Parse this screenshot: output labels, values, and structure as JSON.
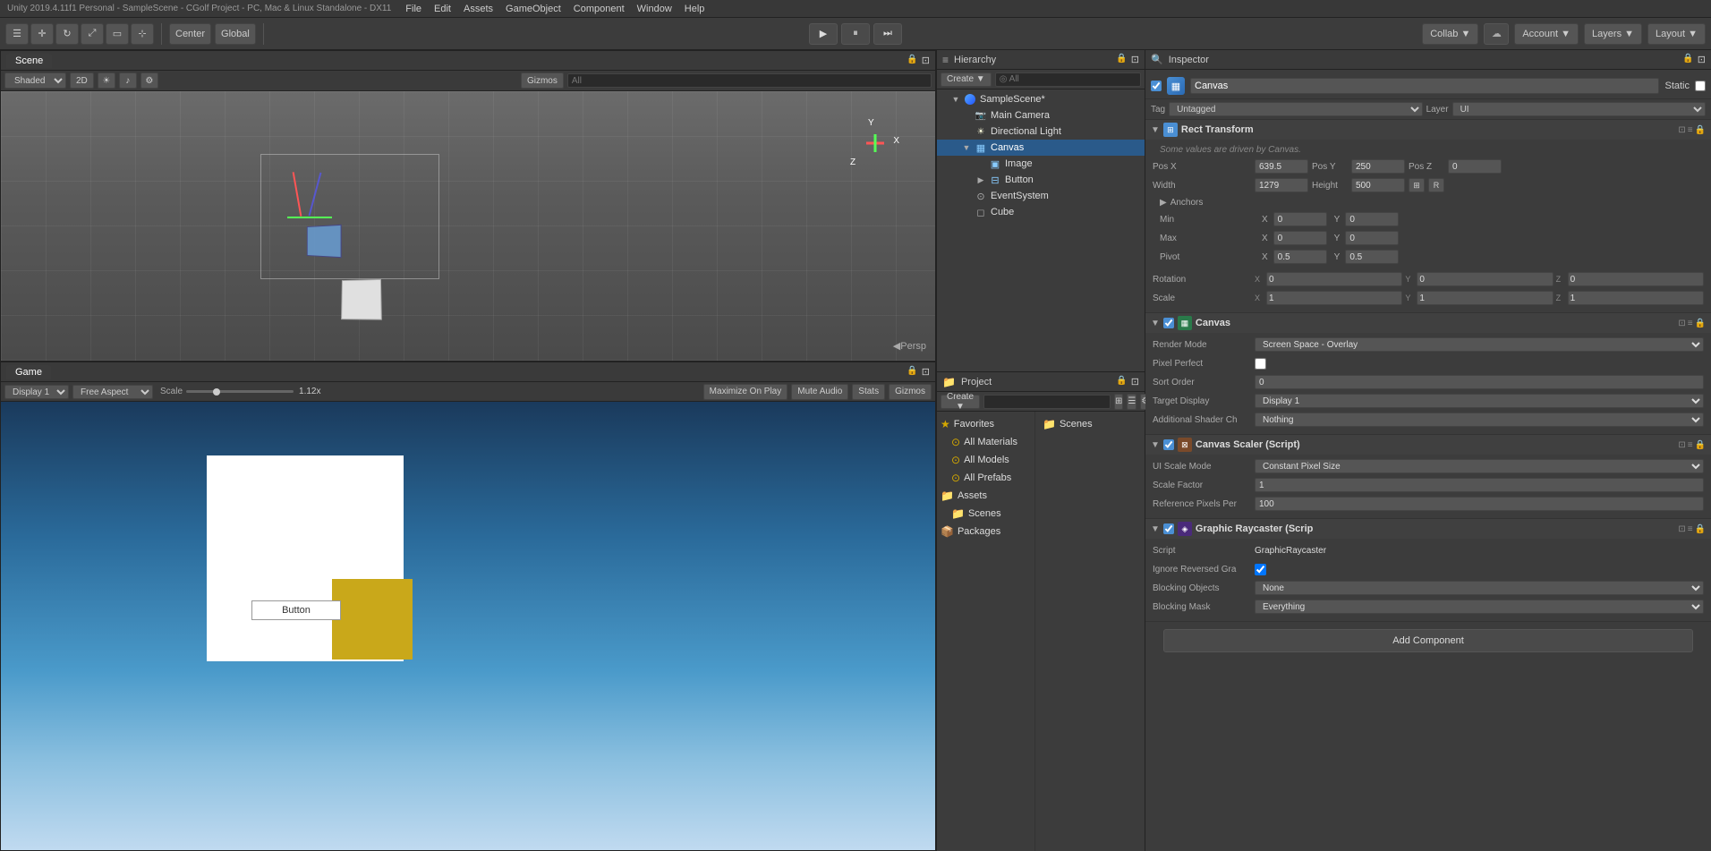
{
  "app": {
    "title": "Unity 2019.4.11f1 Personal - SampleScene - CGolf Project - PC, Mac & Linux Standalone - DX11"
  },
  "menubar": {
    "items": [
      "File",
      "Edit",
      "Assets",
      "GameObject",
      "Component",
      "Window",
      "Help"
    ]
  },
  "toolbar": {
    "transform_tools": [
      "hand",
      "move",
      "rotate",
      "scale",
      "rect",
      "transform"
    ],
    "pivot_center": "Center",
    "pivot_global": "Global",
    "play": "▶",
    "pause": "⏸",
    "step": "⏭",
    "collab": "Collab ▼",
    "account": "Account ▼",
    "layers": "Layers ▼",
    "layout": "Layout ▼"
  },
  "scene": {
    "tab": "Scene",
    "view_mode": "Shaded",
    "gizmos_btn": "Gizmos",
    "search_placeholder": "All",
    "persp_label": "◀Persp"
  },
  "game": {
    "tab": "Game",
    "display": "Display 1",
    "aspect": "Free Aspect",
    "scale_label": "Scale",
    "scale_value": "1.12x",
    "maximize_on_play": "Maximize On Play",
    "mute_audio": "Mute Audio",
    "stats": "Stats",
    "gizmos": "Gizmos",
    "button_label": "Button"
  },
  "hierarchy": {
    "title": "Hierarchy",
    "create_btn": "Create ▼",
    "search_placeholder": "◎ All",
    "scene_name": "SampleScene*",
    "items": [
      {
        "id": "main-camera",
        "label": "Main Camera",
        "indent": 1,
        "icon": "camera"
      },
      {
        "id": "directional-light",
        "label": "Directional Light",
        "indent": 1,
        "icon": "light"
      },
      {
        "id": "canvas",
        "label": "Canvas",
        "indent": 1,
        "icon": "canvas",
        "selected": true,
        "expanded": true
      },
      {
        "id": "image",
        "label": "Image",
        "indent": 2,
        "icon": "image"
      },
      {
        "id": "button",
        "label": "Button",
        "indent": 2,
        "icon": "button",
        "has_children": true
      },
      {
        "id": "eventsystem",
        "label": "EventSystem",
        "indent": 1,
        "icon": "eventsystem"
      },
      {
        "id": "cube",
        "label": "Cube",
        "indent": 1,
        "icon": "cube"
      }
    ]
  },
  "project": {
    "title": "Project",
    "create_btn": "Create ▼",
    "favorites": {
      "label": "Favorites",
      "items": [
        "All Materials",
        "All Models",
        "All Prefabs"
      ]
    },
    "assets": {
      "label": "Assets",
      "items": [
        "Scenes"
      ]
    },
    "packages": "Packages",
    "right_folders": [
      "Scenes"
    ]
  },
  "inspector": {
    "title": "Inspector",
    "object_name": "Canvas",
    "static_label": "Static",
    "tag_label": "Tag",
    "tag_value": "Untagged",
    "layer_label": "Layer",
    "layer_value": "UI",
    "components": [
      {
        "id": "rect-transform",
        "title": "Rect Transform",
        "icon": "⊞",
        "note": "Some values are driven by Canvas.",
        "fields": [
          {
            "label": "Pos X",
            "value": "639.5"
          },
          {
            "label": "Pos Y",
            "value": "250"
          },
          {
            "label": "Pos Z",
            "value": "0"
          },
          {
            "label": "Width",
            "value": "1279"
          },
          {
            "label": "Height",
            "value": "500"
          }
        ],
        "anchors": {
          "min_x": "0",
          "min_y": "0",
          "max_x": "0",
          "max_y": "0"
        },
        "pivot": {
          "x": "0.5",
          "y": "0.5"
        },
        "rotation": {
          "x": "0",
          "y": "0",
          "z": "0"
        },
        "scale": {
          "x": "1",
          "y": "1",
          "z": "1"
        }
      },
      {
        "id": "canvas",
        "title": "Canvas",
        "icon": "▦",
        "checked": true,
        "fields": [
          {
            "label": "Render Mode",
            "value": "Screen Space - Overlay"
          },
          {
            "label": "Pixel Perfect",
            "value": ""
          },
          {
            "label": "Sort Order",
            "value": "0"
          },
          {
            "label": "Target Display",
            "value": "Display 1"
          },
          {
            "label": "Additional Shader Ch",
            "value": "Nothing"
          }
        ]
      },
      {
        "id": "canvas-scaler",
        "title": "Canvas Scaler (Script)",
        "icon": "⊠",
        "checked": true,
        "fields": [
          {
            "label": "UI Scale Mode",
            "value": "Constant Pixel Size"
          },
          {
            "label": "Scale Factor",
            "value": "1"
          },
          {
            "label": "Reference Pixels Per",
            "value": "100"
          }
        ]
      },
      {
        "id": "graphic-raycaster",
        "title": "Graphic Raycaster (Scrip",
        "icon": "◈",
        "checked": true,
        "fields": [
          {
            "label": "Script",
            "value": "GraphicRaycaster"
          },
          {
            "label": "Ignore Reversed Gra",
            "value": "checked"
          },
          {
            "label": "Blocking Objects",
            "value": "None"
          },
          {
            "label": "Blocking Mask",
            "value": "Everything"
          }
        ]
      }
    ],
    "add_component_btn": "Add Component"
  }
}
